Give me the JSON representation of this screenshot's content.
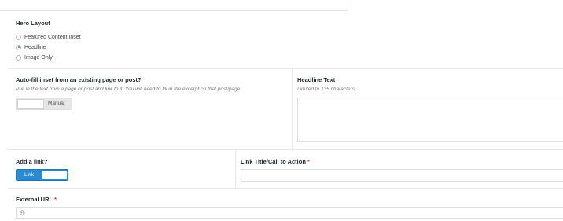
{
  "hero_layout": {
    "title": "Hero Layout",
    "options": [
      {
        "label": "Featured Content Inset",
        "selected": false
      },
      {
        "label": "Headline",
        "selected": true
      },
      {
        "label": "Image Only",
        "selected": false
      }
    ]
  },
  "autofill": {
    "title": "Auto-fill inset from an existing page or post?",
    "hint": "Pull in the text from a page or post and link to it. You will need to fill in the excerpt on that post/page.",
    "toggle_label": "Manual"
  },
  "headline_text": {
    "title": "Headline Text",
    "hint": "Limited to 135 characters",
    "value": ""
  },
  "add_link": {
    "title": "Add a link?",
    "toggle_label": "Link"
  },
  "link_title": {
    "title": "Link Title/Call to Action",
    "required_mark": "*",
    "value": ""
  },
  "external_url": {
    "title": "External URL",
    "required_mark": "*",
    "value": "",
    "icon": "globe-icon"
  },
  "colors": {
    "accent": "#2a8bd1",
    "required": "#d63638"
  }
}
